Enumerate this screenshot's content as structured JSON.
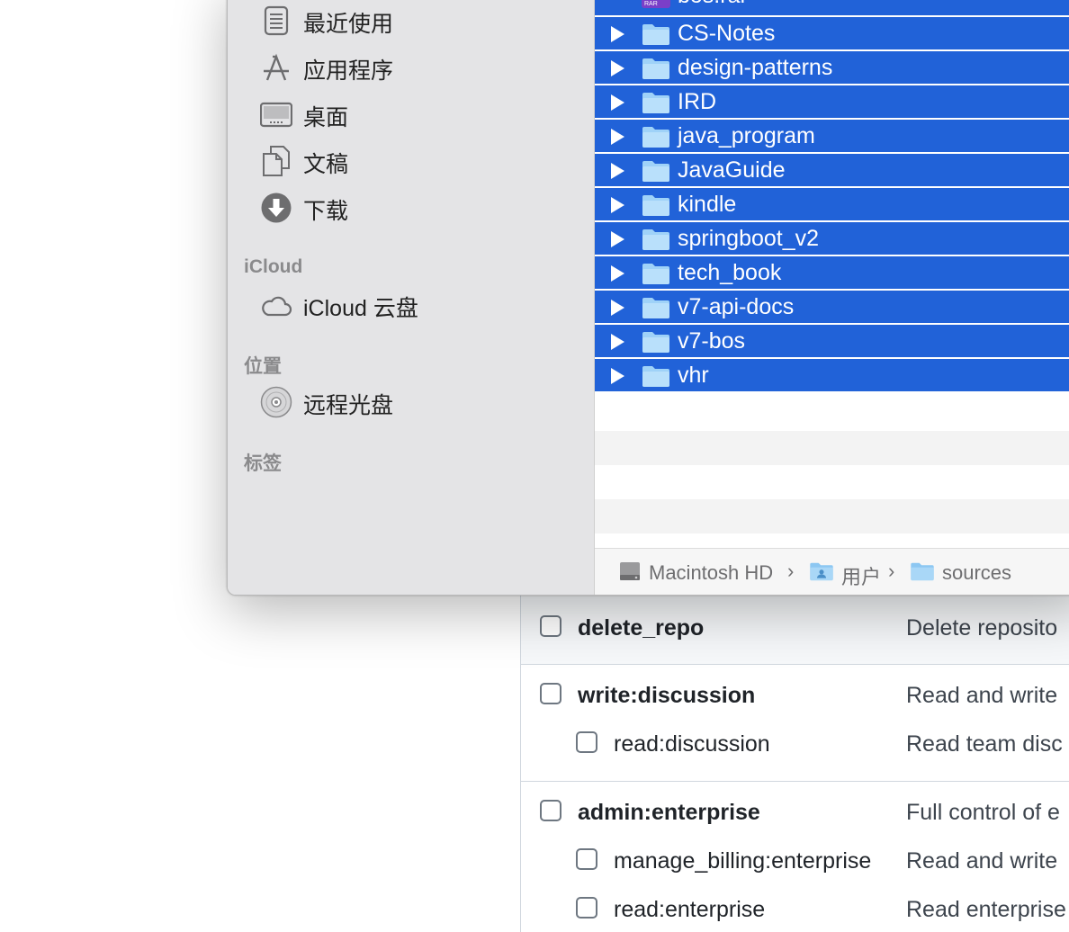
{
  "finder": {
    "sidebar": {
      "favorites": [
        {
          "label": "最近使用",
          "icon": "recents-icon"
        },
        {
          "label": "应用程序",
          "icon": "applications-icon"
        },
        {
          "label": "桌面",
          "icon": "desktop-icon"
        },
        {
          "label": "文稿",
          "icon": "documents-icon"
        },
        {
          "label": "下载",
          "icon": "downloads-icon"
        }
      ],
      "icloud_heading": "iCloud",
      "icloud_items": [
        {
          "label": "iCloud 云盘",
          "icon": "cloud-icon"
        }
      ],
      "locations_heading": "位置",
      "location_items": [
        {
          "label": "远程光盘",
          "icon": "disc-icon"
        }
      ],
      "tags_heading": "标签"
    },
    "files": [
      {
        "name": "bos.rar",
        "type": "rar-archive"
      },
      {
        "name": "CS-Notes",
        "type": "folder"
      },
      {
        "name": "design-patterns",
        "type": "folder"
      },
      {
        "name": "IRD",
        "type": "folder"
      },
      {
        "name": "java_program",
        "type": "folder"
      },
      {
        "name": "JavaGuide",
        "type": "folder"
      },
      {
        "name": "kindle",
        "type": "folder"
      },
      {
        "name": "springboot_v2",
        "type": "folder"
      },
      {
        "name": "tech_book",
        "type": "folder"
      },
      {
        "name": "v7-api-docs",
        "type": "folder"
      },
      {
        "name": "v7-bos",
        "type": "folder"
      },
      {
        "name": "vhr",
        "type": "folder"
      }
    ],
    "rar_badge": "RAR",
    "pathbar": [
      "Macintosh HD",
      "用户",
      "sources"
    ],
    "selection_color": "#2162d8"
  },
  "scopes": {
    "groups": [
      {
        "name": "delete_repo",
        "desc": "Delete reposito",
        "children": []
      },
      {
        "name": "write:discussion",
        "desc": "Read and write",
        "children": [
          {
            "name": "read:discussion",
            "desc": "Read team disc"
          }
        ]
      },
      {
        "name": "admin:enterprise",
        "desc": "Full control of e",
        "children": [
          {
            "name": "manage_billing:enterprise",
            "desc": "Read and write"
          },
          {
            "name": "read:enterprise",
            "desc": "Read enterprise"
          }
        ]
      }
    ]
  }
}
